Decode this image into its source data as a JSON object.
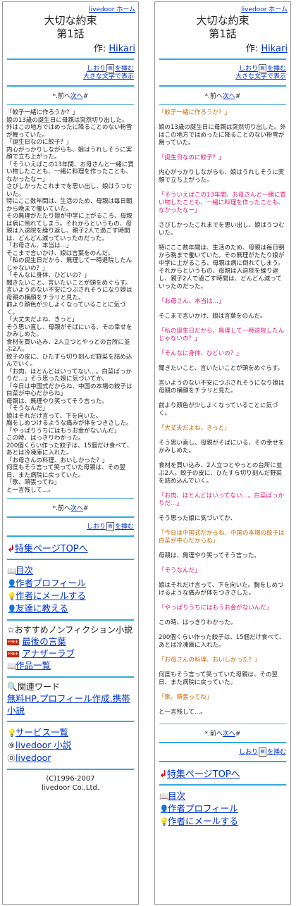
{
  "site": {
    "home_link": "livedoor ホーム"
  },
  "header": {
    "title": "大切な約束",
    "chapter": "第1話",
    "author_prefix": "作: ",
    "author_name": "Hikari"
  },
  "bookmark": {
    "label": "しおり",
    "action": "を挿む",
    "large_text": "大きな文字で表示"
  },
  "nav": {
    "prefix": "*.前へ",
    "next": "次へ",
    "suffix": "#"
  },
  "story_left": [
    "「餃子一緒に作ろうか？」",
    "娘の13歳の誕生日に母親は突然切り出した。",
    "外はこの地方ではめったに降ることのない粉雪が舞っていた。",
    "「誕生日なのに餃子？」",
    "内心がっかりしながらも、娘はうれしそうに実顔で立ち上がった。",
    "「そういえばこの13年間、お母さんと一緒に買い物したことも、一緒に料理を作ったことも、なかったなー」",
    "さびしかったこれまでを思い出し、娘はうつむいた。",
    "特にここ数年間は、生活のため、母親は毎日朝から晩まで働いていた。",
    "その無理がたたり娘が中学に上がるころ、母親は病に倒れてしまう。それからというもの、母親は入退院を繰り返し、親子2人で過ごす時間は、どんどん減っていったのだった。",
    "「お母さん、本当は…」",
    "そこまで言いかけ、娘は言葉をのんだ。",
    "「私の誕生日だから、無理して一時退院したんじゃないの？」",
    "「そんなに身体、ひどいの？」",
    "聞きたいこと、言いたいことが頭をめぐらす。言いようのない不安につぶされそうになり娘は母親の横顔をチラリと見た。",
    "前より顔色が少しよくなっていることに気づく。",
    "「大丈夫だよね、きっと」",
    "そう思い直し、母親がそばにいる、その幸せをかみしめた。",
    "食材を買い込み、2人立つとやっとの台所に並ぶ2人。",
    "餃子の皮に、ひたすら切り刻んだ野菜を詰め込んでいく。",
    "「お肉、ほとんどはいってない…。白菜ばっかりだ…」そう思った娘に気づいてか、",
    "「今日は中国式だからね、中国の本場の餃子は白菜が中心だからね」",
    "母親は、無理やり笑ってそう言った。",
    "「そうなんだ」",
    "娘はそれだけ言って、下を向いた。",
    "胸をしめつけるような痛みが体をつきさした。",
    "「やっぱりうちにはもうお金がないんだ」",
    "この時、はっきりわかった。",
    "200個くらい作った餃子は、15個だけ食べて、あとは冷凍庫に入れた。",
    "「お母さんの料理、おいしかった？」",
    "何度もそう言って笑っていた母親は、その翌日、また病院に戻っていた。",
    "「歌、頑張ってね」",
    "と一言残して…。"
  ],
  "story_right": [
    {
      "t": "「餃子一緒に作ろうか？」",
      "c": "q2"
    },
    {
      "t": "娘の13歳の誕生日に母親は突然切り出した。外はこの地方ではめったに降ることのない粉雪が舞っていた。",
      "c": ""
    },
    {
      "t": "「誕生日なのに餃子？」",
      "c": "q"
    },
    {
      "t": "内心がっかりしながらも、娘はうれしそうに実顔で立ち上がった。",
      "c": ""
    },
    {
      "t": "「そういえばこの13年間、お母さんと一緒に買い物したことも、一緒に料理を作ったことも、なかったなー」",
      "c": "q"
    },
    {
      "t": "さびしかったこれまでを思い出し、娘はうつむいた。",
      "c": ""
    },
    {
      "t": "特にここ数年間は、生活のため、母親は毎日朝から晩まで働いていた。その無理がたたり娘が中学に上がるころ、母親は病に倒れてしまう。それからというもの、母親は入退院を繰り返し、親子2人で過ごす時間は、どんどん減っていったのだった。",
      "c": ""
    },
    {
      "t": "「お母さん、本当は…」",
      "c": "q"
    },
    {
      "t": "そこまで言いかけ、娘は言葉をのんだ。",
      "c": ""
    },
    {
      "t": "「私の誕生日だから、無理して一時退院したんじゃないの？」",
      "c": "q"
    },
    {
      "t": "「そんなに身体、ひどいの？」",
      "c": "q"
    },
    {
      "t": "聞きたいこと、言いたいことが頭をめぐらす。",
      "c": ""
    },
    {
      "t": "言いようのない不安につぶされそうになり娘は母親の横顔をチラリと見た。",
      "c": ""
    },
    {
      "t": "前より顔色が少しよくなっていることに気づく。",
      "c": ""
    },
    {
      "t": "「大丈夫だよね、きっと」",
      "c": "q2"
    },
    {
      "t": "そう思い直し、母親がそばにいる、その幸せをかみしめた。",
      "c": ""
    },
    {
      "t": "食材を買い込み、2人立つとやっとの台所に並ぶ2人。餃子の皮に、ひたすら切り刻んだ野菜を詰め込んでいく。",
      "c": ""
    },
    {
      "t": "「お肉、ほとんどはいってない…。白菜ばっかりだ…」",
      "c": "q"
    },
    {
      "t": "そう思った娘に気づいてか、",
      "c": ""
    },
    {
      "t": "「今日は中国式だからね、中国の本場の餃子は白菜が中心だからね」",
      "c": "q2"
    },
    {
      "t": "母親は、無理やり笑ってそう言った。",
      "c": ""
    },
    {
      "t": "「そうなんだ」",
      "c": "q"
    },
    {
      "t": "娘はそれだけ言って、下を向いた。胸をしめつけるような痛みが体をつきさした。",
      "c": ""
    },
    {
      "t": "「やっぱりうちにはもうお金がないんだ」",
      "c": "q"
    },
    {
      "t": "この時、はっきりわかった。",
      "c": ""
    },
    {
      "t": "200個くらい作った餃子は、15個だけ食べて、あとは冷凍庫に入れた。",
      "c": ""
    },
    {
      "t": "「お母さんの料理、おいしかった？」",
      "c": "q2"
    },
    {
      "t": "何度もそう言って笑っていた母親は、その翌日、また病院に戻っていた。",
      "c": ""
    },
    {
      "t": "「歌、頑張ってね」",
      "c": "q2"
    },
    {
      "t": "と一言残して…。",
      "c": ""
    }
  ],
  "footer": {
    "top_link": "特集ページTOPへ",
    "menu": [
      {
        "icon": "📖",
        "label": "目次"
      },
      {
        "icon": "👤",
        "label": "作者プロフィール"
      },
      {
        "icon": "💡",
        "label": "作者にメールする"
      },
      {
        "icon": "👤",
        "label": "友達に教える"
      }
    ],
    "recommend_title": "☆おすすめノンフィクション小説",
    "recommend": [
      {
        "badge": "FREE",
        "label": "最後の言葉"
      },
      {
        "badge": "FREE",
        "label": "アナザーラブ"
      },
      {
        "badge": "📖",
        "label": "作品一覧"
      }
    ],
    "related_title": "関連ワード",
    "related_links": "無料HP,プロフィール作成,携帯小説",
    "service": {
      "label": "サービス一覧"
    },
    "livedoor_novel": "livedoor 小説",
    "livedoor": "livedoor",
    "copyright_1": "(C)1996-2007",
    "copyright_2": "livedoor Co.,Ltd."
  }
}
